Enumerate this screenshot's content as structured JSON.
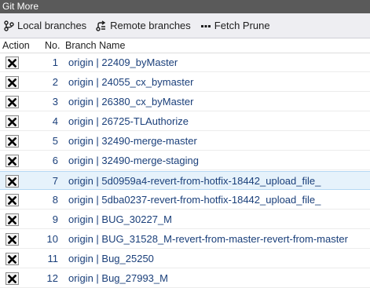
{
  "window": {
    "title": "Git More"
  },
  "toolbar": {
    "local_branches": "Local branches",
    "remote_branches": "Remote branches",
    "fetch_prune": "Fetch Prune"
  },
  "table": {
    "headers": {
      "action": "Action",
      "no": "No.",
      "branch_name": "Branch Name"
    },
    "rows": [
      {
        "no": "1",
        "name": "origin | 22409_byMaster"
      },
      {
        "no": "2",
        "name": "origin | 24055_cx_bymaster"
      },
      {
        "no": "3",
        "name": "origin | 26380_cx_byMaster"
      },
      {
        "no": "4",
        "name": "origin | 26725-TLAuthorize"
      },
      {
        "no": "5",
        "name": "origin | 32490-merge-master"
      },
      {
        "no": "6",
        "name": "origin | 32490-merge-staging"
      },
      {
        "no": "7",
        "name": "origin | 5d0959a4-revert-from-hotfix-18442_upload_file_"
      },
      {
        "no": "8",
        "name": "origin | 5dba0237-revert-from-hotfix-18442_upload_file_"
      },
      {
        "no": "9",
        "name": "origin | BUG_30227_M"
      },
      {
        "no": "10",
        "name": "origin | BUG_31528_M-revert-from-master-revert-from-master"
      },
      {
        "no": "11",
        "name": "origin | Bug_25250"
      },
      {
        "no": "12",
        "name": "origin | Bug_27993_M"
      }
    ],
    "selected_row_no": "7"
  },
  "icons": {
    "local_branches": "branch-icon",
    "remote_branches": "remote-branch-icon",
    "fetch_prune": "ellipsis-icon",
    "delete": "delete-x-icon"
  },
  "colors": {
    "titlebar": "#5a5a5a",
    "toolbar": "#eeeef2",
    "selected_row": "#e6f2fb",
    "link_text": "#1a3f7a"
  }
}
